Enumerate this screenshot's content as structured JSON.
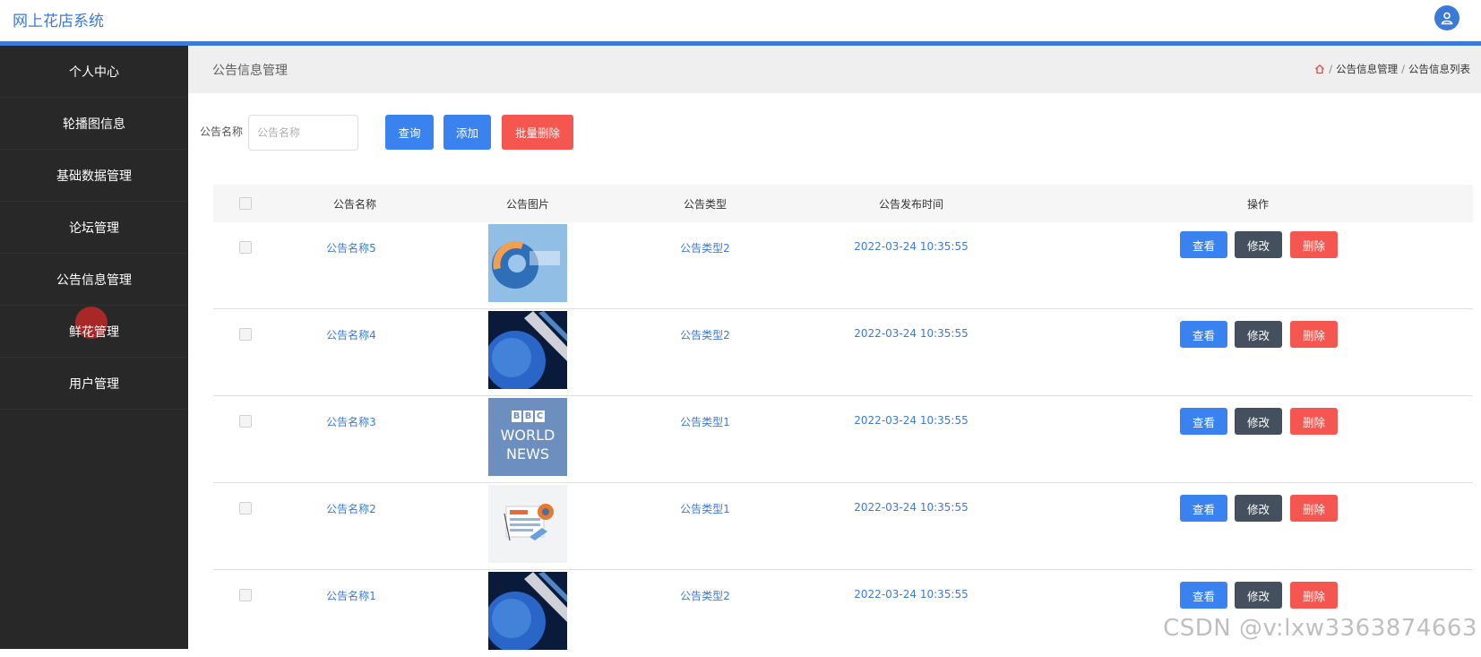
{
  "app": {
    "title": "网上花店系统"
  },
  "sidebar": {
    "items": [
      {
        "label": "个人中心"
      },
      {
        "label": "轮播图信息"
      },
      {
        "label": "基础数据管理"
      },
      {
        "label": "论坛管理"
      },
      {
        "label": "公告信息管理"
      },
      {
        "label": "鲜花管理"
      },
      {
        "label": "用户管理"
      }
    ]
  },
  "header": {
    "title": "公告信息管理",
    "breadcrumb": [
      "公告信息管理",
      "公告信息列表"
    ]
  },
  "search": {
    "label": "公告名称",
    "placeholder": "公告名称",
    "query_label": "查询",
    "add_label": "添加",
    "batch_delete_label": "批量删除"
  },
  "table": {
    "columns": [
      "公告名称",
      "公告图片",
      "公告类型",
      "公告发布时间",
      "操作"
    ],
    "rows": [
      {
        "name": "公告名称5",
        "image": "news-globe-orange",
        "type": "公告类型2",
        "time": "2022-03-24 10:35:55"
      },
      {
        "name": "公告名称4",
        "image": "news-globe-blue",
        "type": "公告类型2",
        "time": "2022-03-24 10:35:55"
      },
      {
        "name": "公告名称3",
        "image": "bbc-world-news",
        "type": "公告类型1",
        "time": "2022-03-24 10:35:55"
      },
      {
        "name": "公告名称2",
        "image": "news-paper-illustration",
        "type": "公告类型1",
        "time": "2022-03-24 10:35:55"
      },
      {
        "name": "公告名称1",
        "image": "news-globe-blue",
        "type": "公告类型2",
        "time": "2022-03-24 10:35:55"
      }
    ],
    "actions": {
      "view": "查看",
      "edit": "修改",
      "delete": "删除"
    }
  },
  "thumb_text": {
    "bbc_b1": "B",
    "bbc_b2": "B",
    "bbc_c": "C",
    "world": "WORLD",
    "news": "NEWS"
  },
  "watermark": "CSDN @v:lxw3363874663",
  "colors": {
    "accent": "#3c7ad8",
    "sidebar": "#282828",
    "danger": "#f5564f",
    "dark_button": "#44505e"
  }
}
